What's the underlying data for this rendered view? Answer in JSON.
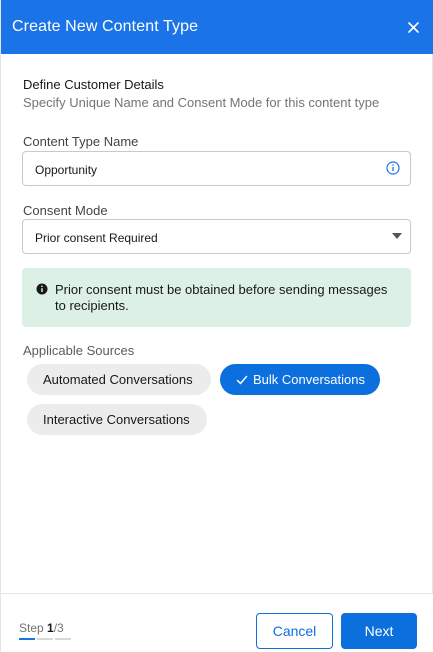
{
  "modal": {
    "title": "Create New Content Type",
    "close_icon": "close-icon"
  },
  "section": {
    "title": "Define Customer Details",
    "subtitle": "Specify Unique Name and Consent Mode for this content type"
  },
  "content_type_name": {
    "label": "Content Type Name",
    "value": "Opportunity",
    "icon": "info-icon"
  },
  "consent_mode": {
    "label": "Consent Mode",
    "selected": "Prior consent Required"
  },
  "notice": {
    "text": "Prior consent must be obtained before sending messages to recipients.",
    "icon": "info-filled-icon",
    "color": "#dcf0e6"
  },
  "sources": {
    "label": "Applicable Sources",
    "chips": [
      {
        "label": "Automated Conversations",
        "selected": false
      },
      {
        "label": "Bulk Conversations",
        "selected": true
      },
      {
        "label": "Interactive Conversations",
        "selected": false
      }
    ]
  },
  "footer": {
    "step_label": "Step",
    "step_current": "1",
    "step_total": "/3",
    "cancel_label": "Cancel",
    "next_label": "Next"
  },
  "colors": {
    "brand": "#1b73e8",
    "primary_button": "#0b6fde"
  }
}
